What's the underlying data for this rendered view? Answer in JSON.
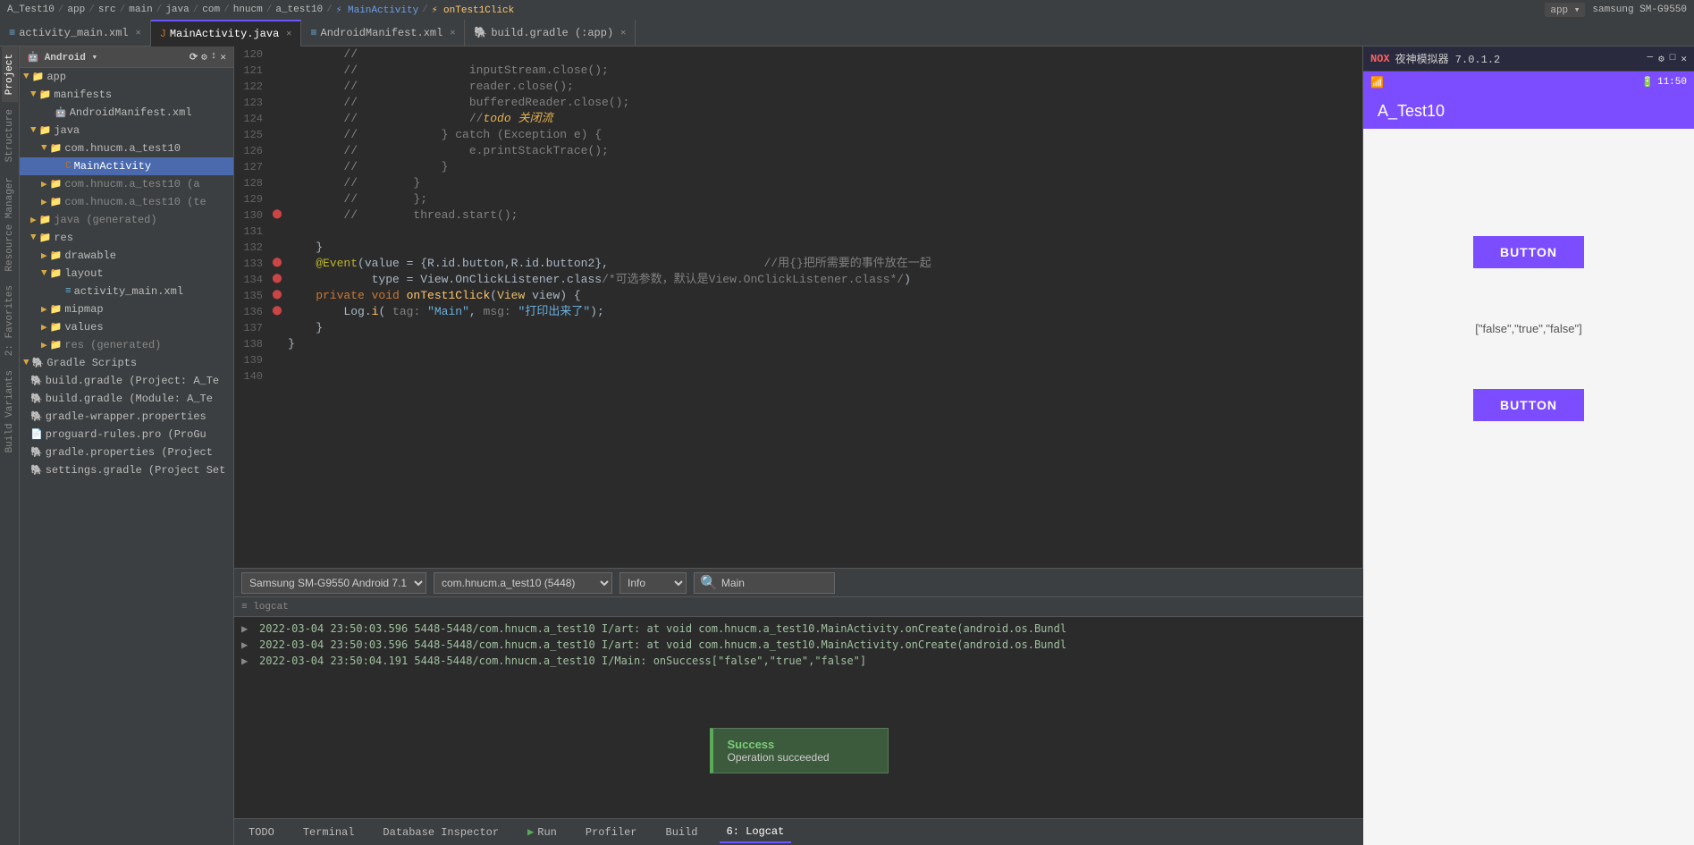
{
  "topbar": {
    "breadcrumb": [
      "A_Test10",
      "app",
      "src",
      "main",
      "java",
      "com",
      "hnucm",
      "a_test10",
      "MainActivity",
      "onTest1Click"
    ],
    "right": [
      "app ▾",
      "samsung SM-G9550"
    ]
  },
  "tabs": [
    {
      "label": "activity_main.xml",
      "active": false,
      "icon": "xml"
    },
    {
      "label": "MainActivity.java",
      "active": true,
      "icon": "java"
    },
    {
      "label": "AndroidManifest.xml",
      "active": false,
      "icon": "xml"
    },
    {
      "label": "build.gradle (:app)",
      "active": false,
      "icon": "gradle"
    }
  ],
  "tree": {
    "header": "Android",
    "items": [
      {
        "indent": 0,
        "type": "folder",
        "label": "app",
        "expanded": true
      },
      {
        "indent": 1,
        "type": "folder",
        "label": "manifests",
        "expanded": true
      },
      {
        "indent": 2,
        "type": "xml",
        "label": "AndroidManifest.xml"
      },
      {
        "indent": 1,
        "type": "folder",
        "label": "java",
        "expanded": true
      },
      {
        "indent": 2,
        "type": "folder",
        "label": "com.hnucm.a_test10",
        "expanded": true
      },
      {
        "indent": 3,
        "type": "java",
        "label": "MainActivity",
        "selected": true
      },
      {
        "indent": 2,
        "type": "folder",
        "label": "com.hnucm.a_test10 (a",
        "gray": true
      },
      {
        "indent": 2,
        "type": "folder",
        "label": "com.hnucm.a_test10 (te",
        "gray": true
      },
      {
        "indent": 1,
        "type": "folder",
        "label": "java (generated)",
        "gray": true
      },
      {
        "indent": 1,
        "type": "folder",
        "label": "res",
        "expanded": true
      },
      {
        "indent": 2,
        "type": "folder",
        "label": "drawable"
      },
      {
        "indent": 2,
        "type": "folder",
        "label": "layout",
        "expanded": true
      },
      {
        "indent": 3,
        "type": "xml",
        "label": "activity_main.xml"
      },
      {
        "indent": 2,
        "type": "folder",
        "label": "mipmap"
      },
      {
        "indent": 2,
        "type": "folder",
        "label": "values"
      },
      {
        "indent": 2,
        "type": "folder",
        "label": "res (generated)",
        "gray": true
      },
      {
        "indent": 0,
        "type": "folder",
        "label": "Gradle Scripts",
        "expanded": true
      },
      {
        "indent": 1,
        "type": "gradle",
        "label": "build.gradle (Project: A_Te"
      },
      {
        "indent": 1,
        "type": "gradle",
        "label": "build.gradle (Module: A_Te"
      },
      {
        "indent": 1,
        "type": "gradle",
        "label": "gradle-wrapper.properties"
      },
      {
        "indent": 1,
        "type": "gradle",
        "label": "proguard-rules.pro (ProGu"
      },
      {
        "indent": 1,
        "type": "gradle",
        "label": "gradle.properties (Project"
      },
      {
        "indent": 1,
        "type": "gradle",
        "label": "settings.gradle (Project Set"
      }
    ]
  },
  "code": {
    "lines": [
      {
        "num": 120,
        "gutter": "",
        "content": "        // ",
        "type": "cm"
      },
      {
        "num": 121,
        "gutter": "",
        "content": "        //                inputStream.close();",
        "type": "cm"
      },
      {
        "num": 122,
        "gutter": "",
        "content": "        //                reader.close();",
        "type": "cm"
      },
      {
        "num": 123,
        "gutter": "",
        "content": "        //                bufferedReader.close();",
        "type": "cm"
      },
      {
        "num": 124,
        "gutter": "",
        "content": "        //                //todo 关闭流",
        "type": "cm_todo"
      },
      {
        "num": 125,
        "gutter": "",
        "content": "        //            } catch (Exception e) {",
        "type": "cm"
      },
      {
        "num": 126,
        "gutter": "",
        "content": "        //                e.printStackTrace();",
        "type": "cm"
      },
      {
        "num": 127,
        "gutter": "",
        "content": "        //            }",
        "type": "cm"
      },
      {
        "num": 128,
        "gutter": "",
        "content": "        //        }",
        "type": "cm"
      },
      {
        "num": 129,
        "gutter": "",
        "content": "        //        };",
        "type": "cm"
      },
      {
        "num": 130,
        "gutter": "bp",
        "content": "        //        thread.start();",
        "type": "cm"
      },
      {
        "num": 131,
        "gutter": "",
        "content": "",
        "type": "normal"
      },
      {
        "num": 132,
        "gutter": "",
        "content": "    }",
        "type": "normal"
      },
      {
        "num": 133,
        "gutter": "bp",
        "content": "    @Event(value = {R.id.button,R.id.button2},            //用{}把所需要的事件放在一起",
        "type": "annotation"
      },
      {
        "num": 134,
        "gutter": "bp",
        "content": "            type = View.OnClickListener.class/*可选参数，默认是View.OnClickListener.class*/)",
        "type": "normal"
      },
      {
        "num": 135,
        "gutter": "bp",
        "content": "    private void onTest1Click(View view) {",
        "type": "method"
      },
      {
        "num": 136,
        "gutter": "bp",
        "content": "        Log.i( tag: \"Main\", msg: \"打印出来了\");",
        "type": "normal"
      },
      {
        "num": 137,
        "gutter": "",
        "content": "    }",
        "type": "normal"
      },
      {
        "num": 138,
        "gutter": "",
        "content": "}",
        "type": "normal"
      },
      {
        "num": 139,
        "gutter": "",
        "content": "",
        "type": "normal"
      },
      {
        "num": 140,
        "gutter": "",
        "content": "",
        "type": "normal"
      }
    ]
  },
  "emulator": {
    "logo": "NОХ 夜神模拟器 7.0.1.2",
    "window_controls": [
      "─",
      "□",
      "✕"
    ],
    "status_bar": {
      "wifi": "▲▼",
      "battery": "🔋",
      "time": "11:50"
    },
    "app_title": "A_Test10",
    "button1_label": "BUTTON",
    "result_text": "[\"false\",\"true\",\"false\"]",
    "button2_label": "BUTTON"
  },
  "logcat": {
    "device": "Samsung SM-G9550 Android 7.1",
    "package": "com.hnucm.a_test10 (5448)",
    "level": "Info",
    "tag": "Main",
    "header": "logcat",
    "logs": [
      {
        "text": "2022-03-04 23:50:03.596 5448-5448/com.hnucm.a_test10 I/art:    at void com.hnucm.a_test10.MainActivity.onCreate(android.os.Bundl"
      },
      {
        "text": "2022-03-04 23:50:03.596 5448-5448/com.hnucm.a_test10 I/art:    at void com.hnucm.a_test10.MainActivity.onCreate(android.os.Bundl"
      },
      {
        "text": "2022-03-04 23:50:04.191 5448-5448/com.hnucm.a_test10 I/Main: onSuccess[\"false\",\"true\",\"false\"]"
      }
    ]
  },
  "toast": {
    "title": "Success",
    "message": "Operation succeeded"
  },
  "bottom_tabs": [
    {
      "label": "TODO"
    },
    {
      "label": "Terminal"
    },
    {
      "label": "Database Inspector"
    },
    {
      "label": "▶ Run"
    },
    {
      "label": "Profiler"
    },
    {
      "label": "Build"
    },
    {
      "label": "6: Logcat",
      "active": true
    }
  ],
  "side_panels": [
    "Project",
    "Structure",
    "2: Favorites",
    "Build Variants"
  ]
}
